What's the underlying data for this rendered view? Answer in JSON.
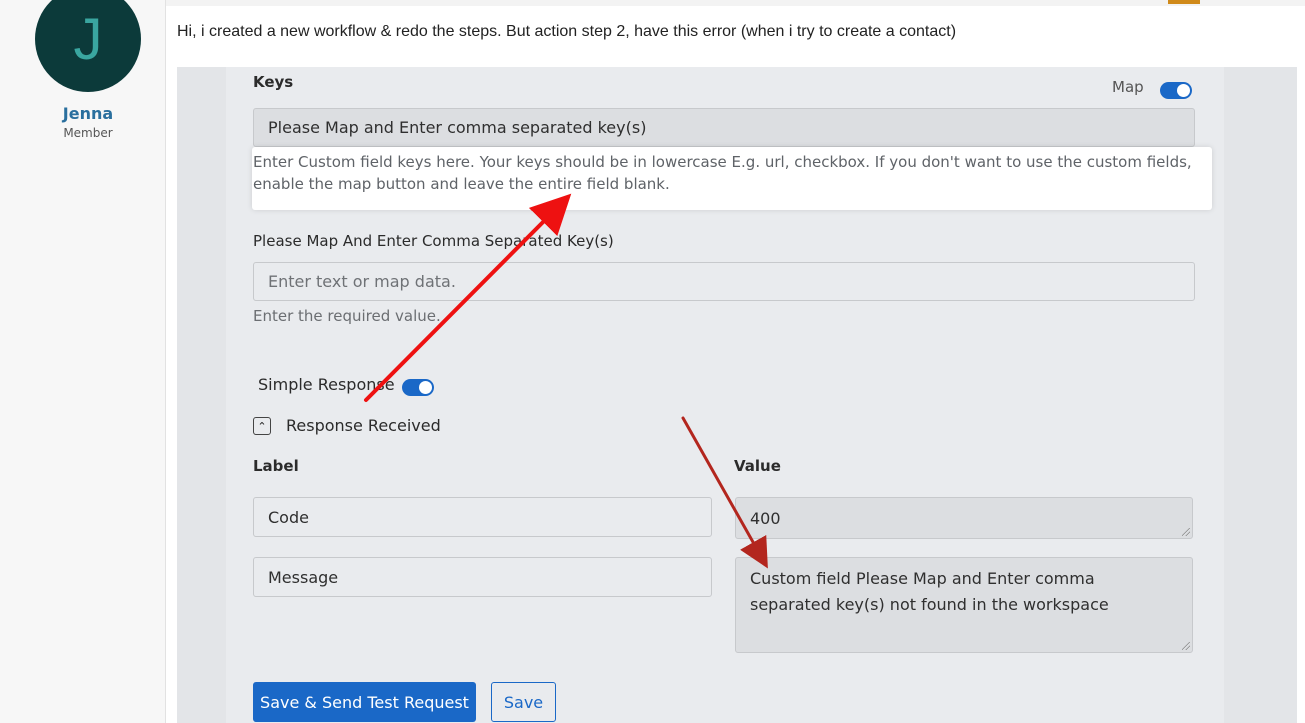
{
  "author": {
    "initial": "J",
    "name": "Jenna",
    "role": "Member"
  },
  "post": {
    "text": "Hi, i created a new workflow & redo the steps. But action step 2, have this error (when i try to create a contact)"
  },
  "form": {
    "keys_label": "Keys",
    "map_label": "Map",
    "keys_value": "Please Map and Enter comma separated key(s)",
    "keys_help": "Enter Custom field keys here. Your keys should be in lowercase E.g. url, checkbox. If you don't want to use the custom fields, enable the map button and leave the entire field blank.",
    "field2_label": "Please Map And Enter Comma Separated Key(s)",
    "field2_placeholder": "Enter text or map data.",
    "field2_help": "Enter the required value.",
    "simple_response_label": "Simple Response",
    "response_received_label": "Response Received",
    "label_header": "Label",
    "value_header": "Value",
    "rows": [
      {
        "label": "Code",
        "value": "400"
      },
      {
        "label": "Message",
        "value": "Custom field Please Map and Enter comma separated key(s) not found in the workspace"
      }
    ],
    "save_test_button": "Save & Send Test Request",
    "save_button": "Save"
  },
  "colors": {
    "accent": "#1a68c7",
    "arrow_red": "#ee1111",
    "arrow_dark_red": "#b3261e",
    "avatar_bg": "#0c3a3a"
  }
}
